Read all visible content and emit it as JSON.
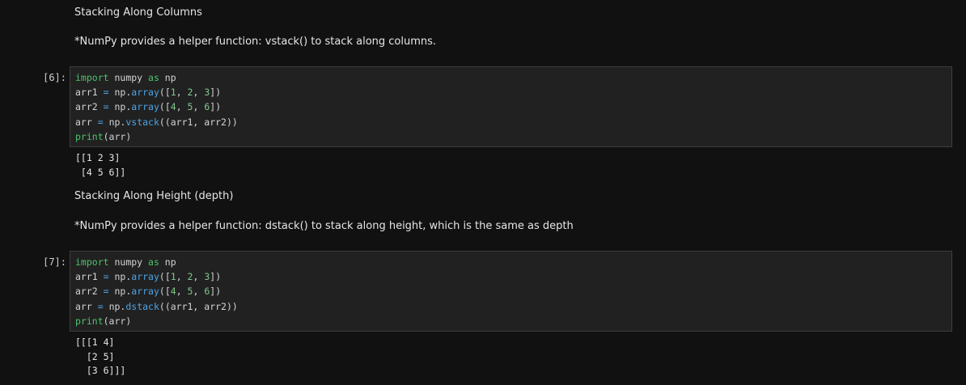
{
  "cells": [
    {
      "type": "markdown",
      "heading": "Stacking Along Columns",
      "text": "*NumPy provides a helper function: vstack() to stack along columns."
    },
    {
      "type": "code",
      "prompt": "[6]:",
      "lines": [
        [
          {
            "t": "import",
            "c": "kw"
          },
          {
            "t": " numpy ",
            "c": ""
          },
          {
            "t": "as",
            "c": "kw"
          },
          {
            "t": " np",
            "c": ""
          }
        ],
        [
          {
            "t": "arr1 ",
            "c": ""
          },
          {
            "t": "=",
            "c": "fn"
          },
          {
            "t": " np.",
            "c": ""
          },
          {
            "t": "array",
            "c": "fn"
          },
          {
            "t": "([",
            "c": ""
          },
          {
            "t": "1",
            "c": "num"
          },
          {
            "t": ", ",
            "c": ""
          },
          {
            "t": "2",
            "c": "num"
          },
          {
            "t": ", ",
            "c": ""
          },
          {
            "t": "3",
            "c": "num"
          },
          {
            "t": "])",
            "c": ""
          }
        ],
        [
          {
            "t": "arr2 ",
            "c": ""
          },
          {
            "t": "=",
            "c": "fn"
          },
          {
            "t": " np.",
            "c": ""
          },
          {
            "t": "array",
            "c": "fn"
          },
          {
            "t": "([",
            "c": ""
          },
          {
            "t": "4",
            "c": "num"
          },
          {
            "t": ", ",
            "c": ""
          },
          {
            "t": "5",
            "c": "num"
          },
          {
            "t": ", ",
            "c": ""
          },
          {
            "t": "6",
            "c": "num"
          },
          {
            "t": "])",
            "c": ""
          }
        ],
        [
          {
            "t": "arr ",
            "c": ""
          },
          {
            "t": "=",
            "c": "fn"
          },
          {
            "t": " np.",
            "c": ""
          },
          {
            "t": "vstack",
            "c": "fn"
          },
          {
            "t": "((arr1, arr2))",
            "c": ""
          }
        ],
        [
          {
            "t": "print",
            "c": "pr"
          },
          {
            "t": "(arr)",
            "c": ""
          }
        ]
      ],
      "output": "[[1 2 3]\n [4 5 6]]"
    },
    {
      "type": "markdown",
      "heading": "Stacking Along Height (depth)",
      "text": "*NumPy provides a helper function: dstack() to stack along height, which is the same as depth"
    },
    {
      "type": "code",
      "prompt": "[7]:",
      "lines": [
        [
          {
            "t": "import",
            "c": "kw"
          },
          {
            "t": " numpy ",
            "c": ""
          },
          {
            "t": "as",
            "c": "kw"
          },
          {
            "t": " np",
            "c": ""
          }
        ],
        [
          {
            "t": "arr1 ",
            "c": ""
          },
          {
            "t": "=",
            "c": "fn"
          },
          {
            "t": " np.",
            "c": ""
          },
          {
            "t": "array",
            "c": "fn"
          },
          {
            "t": "([",
            "c": ""
          },
          {
            "t": "1",
            "c": "num"
          },
          {
            "t": ", ",
            "c": ""
          },
          {
            "t": "2",
            "c": "num"
          },
          {
            "t": ", ",
            "c": ""
          },
          {
            "t": "3",
            "c": "num"
          },
          {
            "t": "])",
            "c": ""
          }
        ],
        [
          {
            "t": "arr2 ",
            "c": ""
          },
          {
            "t": "=",
            "c": "fn"
          },
          {
            "t": " np.",
            "c": ""
          },
          {
            "t": "array",
            "c": "fn"
          },
          {
            "t": "([",
            "c": ""
          },
          {
            "t": "4",
            "c": "num"
          },
          {
            "t": ", ",
            "c": ""
          },
          {
            "t": "5",
            "c": "num"
          },
          {
            "t": ", ",
            "c": ""
          },
          {
            "t": "6",
            "c": "num"
          },
          {
            "t": "])",
            "c": ""
          }
        ],
        [
          {
            "t": "arr ",
            "c": ""
          },
          {
            "t": "=",
            "c": "fn"
          },
          {
            "t": " np.",
            "c": ""
          },
          {
            "t": "dstack",
            "c": "fn"
          },
          {
            "t": "((arr1, arr2))",
            "c": ""
          }
        ],
        [
          {
            "t": "print",
            "c": "pr"
          },
          {
            "t": "(arr)",
            "c": ""
          }
        ]
      ],
      "output": "[[[1 4]\n  [2 5]\n  [3 6]]]"
    }
  ],
  "theme": {
    "background": "#111111",
    "code_background": "#212121",
    "keyword_color": "#4ec26a",
    "function_color": "#4fa3e3",
    "number_color": "#7fc98a"
  }
}
